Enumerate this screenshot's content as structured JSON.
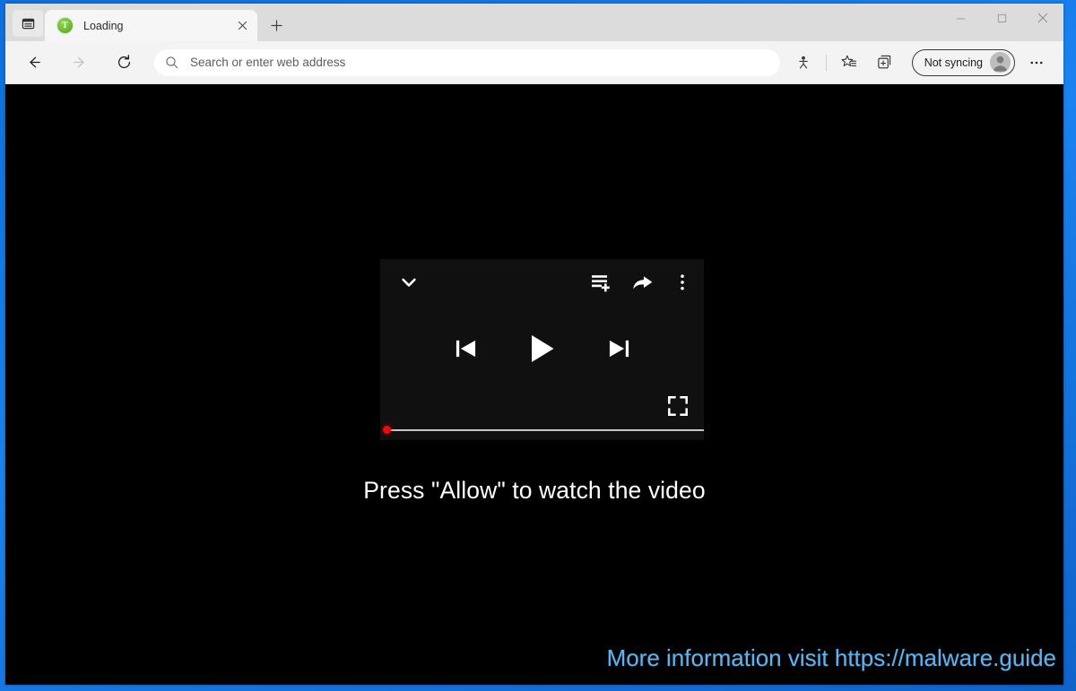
{
  "window": {
    "controls": {
      "minimize": "minimize",
      "maximize": "maximize",
      "close": "close"
    }
  },
  "tabstrip": {
    "tab_actions_label": "tab-actions",
    "tabs": [
      {
        "title": "Loading",
        "favicon": "green-circle-favicon",
        "favicon_letter": "T",
        "favicon_color": "#6fbe2e",
        "active": true,
        "close_label": "close-tab"
      }
    ],
    "new_tab_label": "new-tab"
  },
  "navbar": {
    "back_label": "Back",
    "forward_label": "Forward",
    "refresh_label": "Refresh",
    "back_enabled": true,
    "forward_enabled": false,
    "omnibox": {
      "value": "",
      "placeholder": "Search or enter web address",
      "icon": "search-icon"
    },
    "right_icons": [
      {
        "name": "site-permissions-icon",
        "label": "Site permissions"
      },
      {
        "name": "favorites-icon",
        "label": "Favorites"
      },
      {
        "name": "collections-icon",
        "label": "Collections"
      }
    ],
    "profile": {
      "label": "Not syncing",
      "avatar": "person-avatar"
    },
    "settings_label": "Settings and more"
  },
  "page": {
    "background_color": "#000000",
    "player": {
      "background_color": "#101010",
      "collapse_icon": "chevron-down-icon",
      "top_icons": [
        {
          "name": "add-to-queue-icon",
          "label": "Add to queue"
        },
        {
          "name": "share-icon",
          "label": "Share"
        },
        {
          "name": "more-options-icon",
          "label": "More options"
        }
      ],
      "controls": [
        {
          "name": "previous-track-button",
          "label": "Previous"
        },
        {
          "name": "play-button",
          "label": "Play"
        },
        {
          "name": "next-track-button",
          "label": "Next"
        }
      ],
      "fullscreen_icon": "fullscreen-icon",
      "progress": {
        "value_percent": 0,
        "scrubber_color": "#ec0a0a",
        "track_color": "#c7c7c7"
      }
    },
    "headline": "Press \"Allow\" to watch the video",
    "watermark": "More information visit https://malware.guide",
    "watermark_color": "#5cb3ef"
  }
}
